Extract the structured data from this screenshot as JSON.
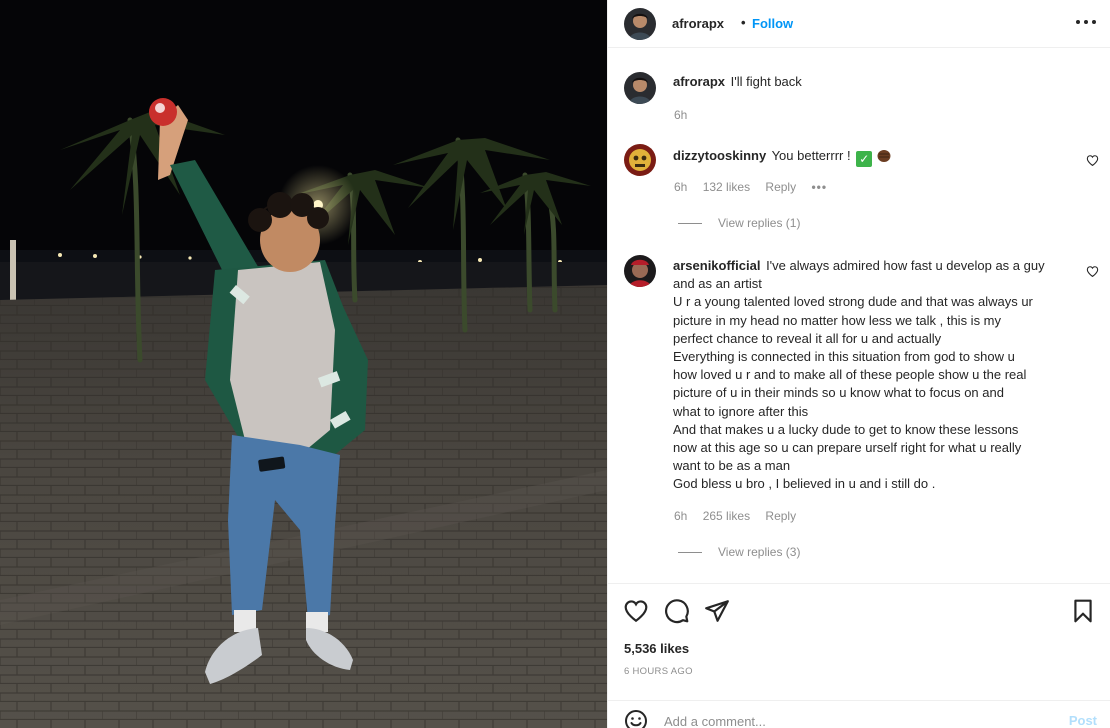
{
  "post": {
    "author": "afrorapx",
    "separator": "•",
    "follow_label": "Follow",
    "more_icon": "more-horizontal-icon"
  },
  "caption": {
    "username": "afrorapx",
    "text": "I'll fight back",
    "time": "6h"
  },
  "comments": [
    {
      "username": "dizzytooskinny",
      "text": "You betterrrr !",
      "emojis": [
        "check-mark-emoji",
        "fist-emoji"
      ],
      "time": "6h",
      "likes": "132 likes",
      "reply_label": "Reply",
      "more": "•••",
      "view_replies": "View replies (1)"
    },
    {
      "username": "arsenikofficial",
      "text_lines": [
        "I've always admired how fast u develop as a guy",
        "and as an artist",
        "U r a young talented loved strong dude and that was always ur",
        "picture in my head no matter how less we talk , this is my",
        "perfect chance to reveal it all for u and actually",
        "Everything is connected in this situation from god to show u",
        "how loved u r and to make all of these people show u the real",
        "picture of u in their minds so u know what to focus on and",
        "what to ignore after this",
        "And that makes u a lucky dude to get to know these lessons",
        "now at this age so u can prepare urself right for what u really",
        "want to be as a man",
        "God bless u bro , I believed in u and i still do ."
      ],
      "time": "6h",
      "likes": "265 likes",
      "reply_label": "Reply",
      "view_replies": "View replies (3)"
    }
  ],
  "actions": {
    "icons": [
      "heart-icon",
      "comment-icon",
      "share-icon",
      "bookmark-icon"
    ],
    "likes_count": "5,536 likes",
    "timestamp": "6 HOURS AGO"
  },
  "add_comment": {
    "placeholder": "Add a comment...",
    "post_label": "Post"
  },
  "colors": {
    "accent": "#0095f6",
    "post_disabled": "#b2dffc",
    "secondary_text": "#8e8e8e",
    "photo_background": "#050507"
  }
}
